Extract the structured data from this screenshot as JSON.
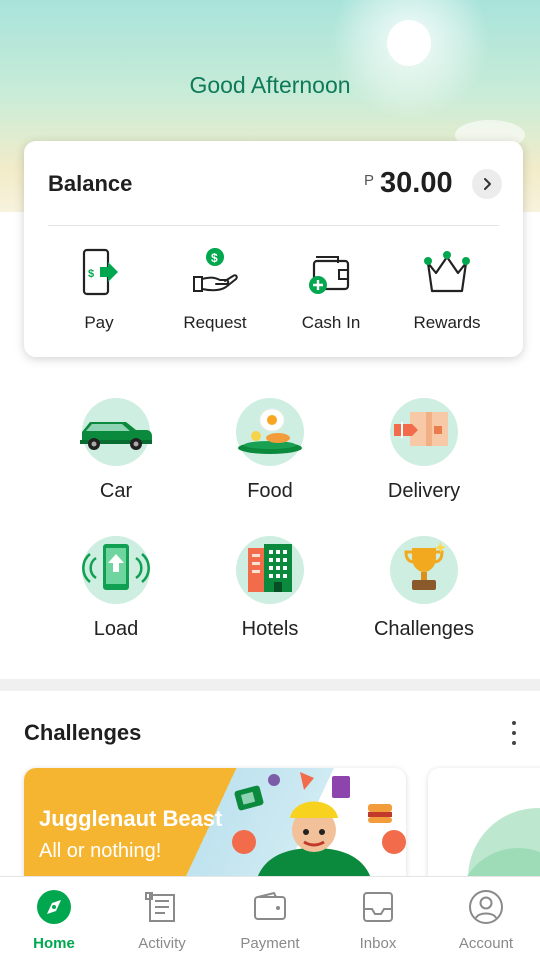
{
  "header": {
    "greeting": "Good Afternoon"
  },
  "balance": {
    "label": "Balance",
    "currency_symbol": "P",
    "amount": "30.00"
  },
  "actions": [
    {
      "label": "Pay",
      "icon": "phone-send-money-icon"
    },
    {
      "label": "Request",
      "icon": "hand-coin-icon"
    },
    {
      "label": "Cash In",
      "icon": "wallet-plus-icon"
    },
    {
      "label": "Rewards",
      "icon": "crown-icon"
    }
  ],
  "services": [
    {
      "label": "Car",
      "icon": "car-icon"
    },
    {
      "label": "Food",
      "icon": "food-plate-icon"
    },
    {
      "label": "Delivery",
      "icon": "package-icon"
    },
    {
      "label": "Load",
      "icon": "phone-topup-icon"
    },
    {
      "label": "Hotels",
      "icon": "hotel-icon"
    },
    {
      "label": "Challenges",
      "icon": "trophy-icon"
    }
  ],
  "challenges": {
    "title": "Challenges",
    "promo": {
      "title": "Jugglenaut Beast",
      "subtitle": "All or nothing!"
    }
  },
  "bottom_nav": [
    {
      "label": "Home",
      "icon": "compass-icon",
      "active": true
    },
    {
      "label": "Activity",
      "icon": "receipt-icon",
      "active": false
    },
    {
      "label": "Payment",
      "icon": "wallet-icon",
      "active": false
    },
    {
      "label": "Inbox",
      "icon": "inbox-tray-icon",
      "active": false
    },
    {
      "label": "Account",
      "icon": "user-circle-icon",
      "active": false
    }
  ],
  "colors": {
    "brand_green": "#00a74e",
    "greeting_green": "#0e7a5a",
    "service_circle": "#cdeee0",
    "promo_orange": "#f6b530"
  }
}
